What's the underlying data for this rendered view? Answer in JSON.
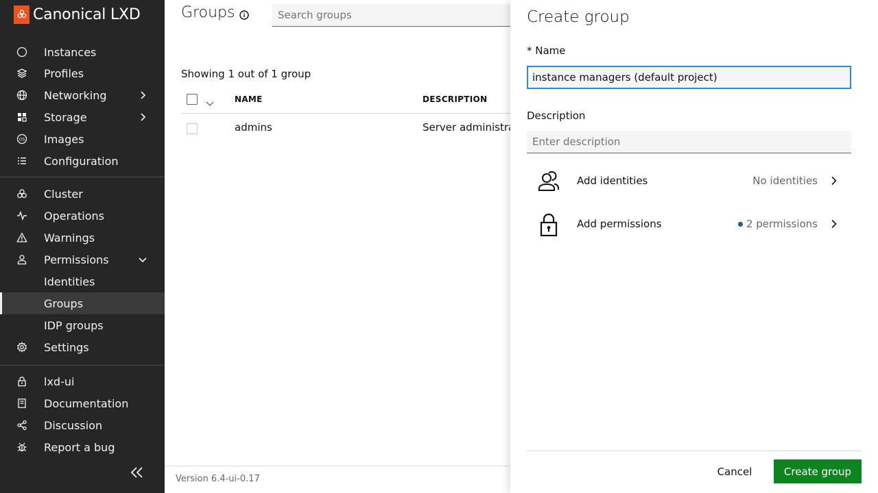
{
  "app": {
    "brand": "Canonical LXD"
  },
  "sidebar": {
    "items": [
      {
        "label": "Instances",
        "icon": "instances-icon"
      },
      {
        "label": "Profiles",
        "icon": "profiles-icon"
      },
      {
        "label": "Networking",
        "icon": "networking-icon"
      },
      {
        "label": "Storage",
        "icon": "storage-icon"
      },
      {
        "label": "Images",
        "icon": "images-icon"
      },
      {
        "label": "Configuration",
        "icon": "configuration-icon"
      },
      {
        "label": "Cluster",
        "icon": "cluster-icon"
      },
      {
        "label": "Operations",
        "icon": "operations-icon"
      },
      {
        "label": "Warnings",
        "icon": "warning-icon"
      },
      {
        "label": "Permissions",
        "icon": "user-icon"
      },
      {
        "label": "Identities"
      },
      {
        "label": "Groups"
      },
      {
        "label": "IDP groups"
      },
      {
        "label": "Settings",
        "icon": "gear-icon"
      },
      {
        "label": "lxd-ui",
        "icon": "lock-icon"
      },
      {
        "label": "Documentation",
        "icon": "document-icon"
      },
      {
        "label": "Discussion",
        "icon": "share-icon"
      },
      {
        "label": "Report a bug",
        "icon": "bug-icon"
      }
    ]
  },
  "main": {
    "title": "Groups",
    "search_placeholder": "Search groups",
    "showing": "Showing 1 out of 1 group",
    "columns": [
      "NAME",
      "DESCRIPTION"
    ],
    "rows": [
      {
        "name": "admins",
        "description": "Server administrat"
      }
    ],
    "version": "Version 6.4-ui-0.17"
  },
  "panel": {
    "title": "Create group",
    "name_label": "* Name",
    "name_value": "instance managers (default project)",
    "description_label": "Description",
    "description_placeholder": "Enter description",
    "identities": {
      "label": "Add identities",
      "status": "No identities"
    },
    "permissions": {
      "label": "Add permissions",
      "status": "2 permissions"
    },
    "cancel_label": "Cancel",
    "create_label": "Create group"
  },
  "colors": {
    "accent": "#0e8420",
    "brand": "#e95420",
    "focus": "#2a8ad4",
    "sidebar_bg": "#262626"
  }
}
